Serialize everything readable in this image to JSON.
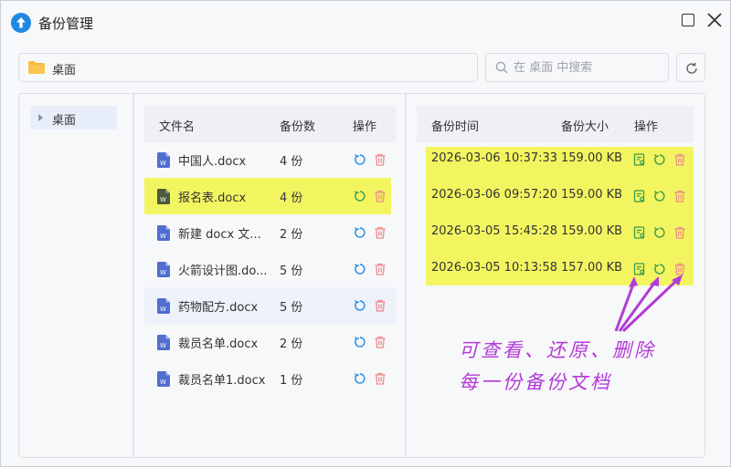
{
  "window": {
    "title": "备份管理"
  },
  "path": {
    "current": "桌面"
  },
  "search": {
    "placeholder": "在 桌面 中搜索"
  },
  "tree": {
    "items": [
      {
        "label": "桌面"
      }
    ]
  },
  "files": {
    "headers": {
      "name": "文件名",
      "count": "备份数",
      "action": "操作"
    },
    "rows": [
      {
        "name": "中国人.docx",
        "count": "4 份"
      },
      {
        "name": "报名表.docx",
        "count": "4 份"
      },
      {
        "name": "新建 docx 文...",
        "count": "2 份"
      },
      {
        "name": "火箭设计图.do...",
        "count": "5 份"
      },
      {
        "name": "药物配方.docx",
        "count": "5 份"
      },
      {
        "name": "裁员名单.docx",
        "count": "2 份"
      },
      {
        "name": "裁员名单1.docx",
        "count": "1 份"
      }
    ]
  },
  "backups": {
    "headers": {
      "time": "备份时间",
      "size": "备份大小",
      "action": "操作"
    },
    "rows": [
      {
        "time": "2026-03-06 10:37:33",
        "size": "159.00 KB"
      },
      {
        "time": "2026-03-06 09:57:20",
        "size": "159.00 KB"
      },
      {
        "time": "2026-03-05 15:45:28",
        "size": "159.00 KB"
      },
      {
        "time": "2026-03-05 10:13:58",
        "size": "157.00 KB"
      }
    ]
  },
  "annotation": {
    "line1": "可查看、还原、删除",
    "line2": "每一份备份文档"
  },
  "colors": {
    "accent": "#1e88e5",
    "delete": "#f08a8a",
    "view": "#3e9a4a",
    "highlight": "#f2f560",
    "annotation": "#b33bd6",
    "doc_icon": "#4f6ed1"
  }
}
